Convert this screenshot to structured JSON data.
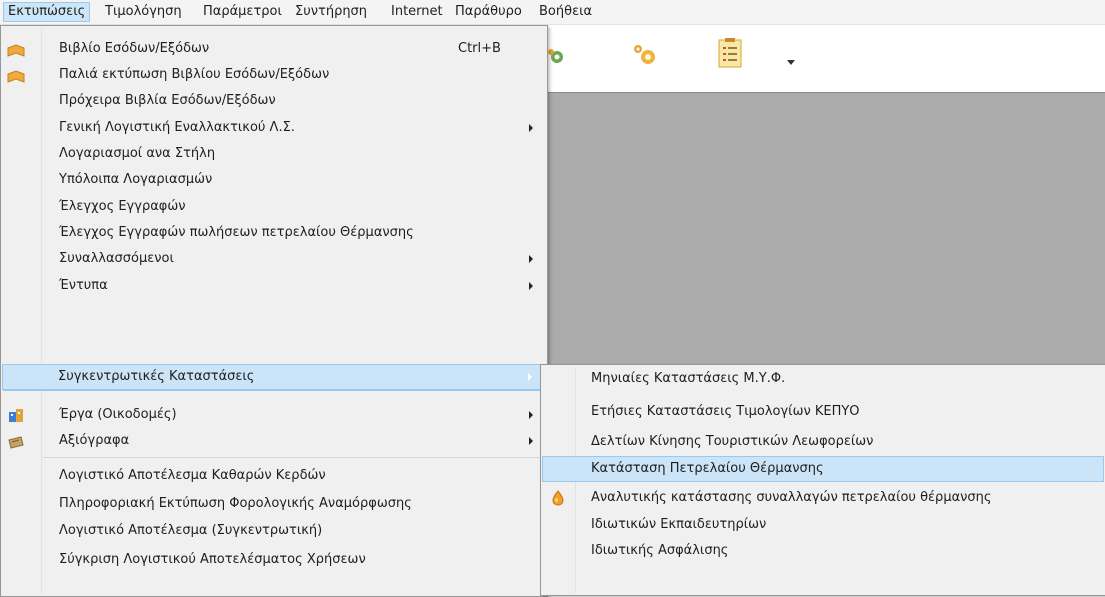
{
  "menubar": {
    "items": [
      "Εκτυπώσεις",
      "Τιμολόγηση",
      "Παράμετροι",
      "Συντήρηση",
      "Internet",
      "Παράθυρο",
      "Βοήθεια"
    ]
  },
  "print_menu": {
    "items": [
      {
        "label": "Βιβλίο Εσόδων/Εξόδων",
        "shortcut": "Ctrl+B",
        "icon": "book-icon"
      },
      {
        "label": "Παλιά εκτύπωση Βιβλίου Εσόδων/Εξόδων",
        "icon": "book-icon"
      },
      {
        "label": "Πρόχειρα Βιβλία Εσόδων/Εξόδων"
      },
      {
        "label": "Γενική Λογιστική Εναλλακτικού Λ.Σ.",
        "submenu": true
      },
      {
        "label": "Λογαριασμοί ανα Στήλη"
      },
      {
        "label": "Υπόλοιπα Λογαριασμών"
      },
      {
        "label": "Έλεγχος Εγγραφών"
      },
      {
        "label": "Έλεγχος Εγγραφών πωλήσεων πετρελαίου Θέρμανσης"
      },
      {
        "label": "Συναλλασσόμενοι",
        "submenu": true
      },
      {
        "label": "Έντυπα",
        "submenu": true
      },
      {
        "label": "Συγκεντρωτικές Καταστάσεις",
        "submenu": true,
        "highlighted": true
      },
      {
        "label": "Έργα (Οικοδομές)",
        "submenu": true,
        "icon": "building-icon"
      },
      {
        "label": "Αξιόγραφα",
        "submenu": true,
        "icon": "cheque-icon"
      },
      {
        "label": "Λογιστικό Αποτέλεσμα Καθαρών Κερδών"
      },
      {
        "label": "Πληροφοριακή Εκτύπωση Φορολογικής Αναμόρφωσης"
      },
      {
        "label": "Λογιστικό Αποτέλεσμα (Συγκεντρωτική)"
      },
      {
        "label": "Σύγκριση Λογιστικού Αποτελέσματος Χρήσεων"
      }
    ]
  },
  "summary_submenu": {
    "items": [
      {
        "label": "Μηνιαίες Καταστάσεις Μ.Υ.Φ."
      },
      {
        "label": "Ετήσιες Καταστάσεις Τιμολογίων ΚΕΠΥΟ"
      },
      {
        "label": "Δελτίων Κίνησης Τουριστικών Λεωφορείων"
      },
      {
        "label": "Κατάσταση Πετρελαίου Θέρμανσης",
        "highlighted": true
      },
      {
        "label": "Αναλυτικής κατάστασης συναλλαγών πετρελαίου θέρμανσης",
        "icon": "oil-drop-icon"
      },
      {
        "label": "Ιδιωτικών Εκπαιδευτηρίων"
      },
      {
        "label": "Ιδιωτικής Ασφάλισης"
      }
    ]
  }
}
